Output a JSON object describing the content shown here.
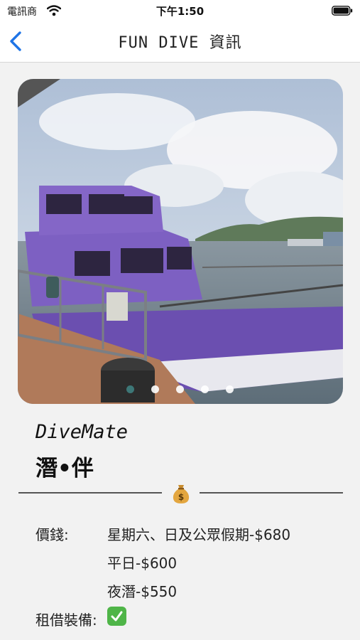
{
  "status_bar": {
    "carrier": "電訊商",
    "time": "下午1:50"
  },
  "nav": {
    "title": "FUN DIVE 資訊"
  },
  "carousel": {
    "page_count": 5,
    "current_page": 1
  },
  "brand": {
    "name_en": "DiveMate",
    "name_zh": "潛•伴"
  },
  "pricing": {
    "label": "價錢:",
    "items": [
      "星期六、日及公眾假期-$680",
      "平日-$600",
      "夜潛-$550"
    ]
  },
  "equipment": {
    "label": "租借裝備:",
    "available": true
  },
  "colors": {
    "accent": "#1e74e6",
    "dot_active": "#3f7f80",
    "check_green": "#4fb548",
    "boat_purple": "#6b4fb0"
  }
}
